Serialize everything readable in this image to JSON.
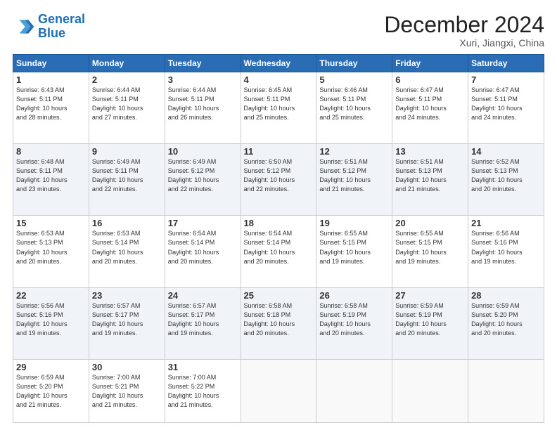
{
  "logo": {
    "line1": "General",
    "line2": "Blue"
  },
  "title": "December 2024",
  "location": "Xuri, Jiangxi, China",
  "days_of_week": [
    "Sunday",
    "Monday",
    "Tuesday",
    "Wednesday",
    "Thursday",
    "Friday",
    "Saturday"
  ],
  "weeks": [
    [
      {
        "day": "1",
        "info": "Sunrise: 6:43 AM\nSunset: 5:11 PM\nDaylight: 10 hours\nand 28 minutes."
      },
      {
        "day": "2",
        "info": "Sunrise: 6:44 AM\nSunset: 5:11 PM\nDaylight: 10 hours\nand 27 minutes."
      },
      {
        "day": "3",
        "info": "Sunrise: 6:44 AM\nSunset: 5:11 PM\nDaylight: 10 hours\nand 26 minutes."
      },
      {
        "day": "4",
        "info": "Sunrise: 6:45 AM\nSunset: 5:11 PM\nDaylight: 10 hours\nand 25 minutes."
      },
      {
        "day": "5",
        "info": "Sunrise: 6:46 AM\nSunset: 5:11 PM\nDaylight: 10 hours\nand 25 minutes."
      },
      {
        "day": "6",
        "info": "Sunrise: 6:47 AM\nSunset: 5:11 PM\nDaylight: 10 hours\nand 24 minutes."
      },
      {
        "day": "7",
        "info": "Sunrise: 6:47 AM\nSunset: 5:11 PM\nDaylight: 10 hours\nand 24 minutes."
      }
    ],
    [
      {
        "day": "8",
        "info": "Sunrise: 6:48 AM\nSunset: 5:11 PM\nDaylight: 10 hours\nand 23 minutes."
      },
      {
        "day": "9",
        "info": "Sunrise: 6:49 AM\nSunset: 5:11 PM\nDaylight: 10 hours\nand 22 minutes."
      },
      {
        "day": "10",
        "info": "Sunrise: 6:49 AM\nSunset: 5:12 PM\nDaylight: 10 hours\nand 22 minutes."
      },
      {
        "day": "11",
        "info": "Sunrise: 6:50 AM\nSunset: 5:12 PM\nDaylight: 10 hours\nand 22 minutes."
      },
      {
        "day": "12",
        "info": "Sunrise: 6:51 AM\nSunset: 5:12 PM\nDaylight: 10 hours\nand 21 minutes."
      },
      {
        "day": "13",
        "info": "Sunrise: 6:51 AM\nSunset: 5:13 PM\nDaylight: 10 hours\nand 21 minutes."
      },
      {
        "day": "14",
        "info": "Sunrise: 6:52 AM\nSunset: 5:13 PM\nDaylight: 10 hours\nand 20 minutes."
      }
    ],
    [
      {
        "day": "15",
        "info": "Sunrise: 6:53 AM\nSunset: 5:13 PM\nDaylight: 10 hours\nand 20 minutes."
      },
      {
        "day": "16",
        "info": "Sunrise: 6:53 AM\nSunset: 5:14 PM\nDaylight: 10 hours\nand 20 minutes."
      },
      {
        "day": "17",
        "info": "Sunrise: 6:54 AM\nSunset: 5:14 PM\nDaylight: 10 hours\nand 20 minutes."
      },
      {
        "day": "18",
        "info": "Sunrise: 6:54 AM\nSunset: 5:14 PM\nDaylight: 10 hours\nand 20 minutes."
      },
      {
        "day": "19",
        "info": "Sunrise: 6:55 AM\nSunset: 5:15 PM\nDaylight: 10 hours\nand 19 minutes."
      },
      {
        "day": "20",
        "info": "Sunrise: 6:55 AM\nSunset: 5:15 PM\nDaylight: 10 hours\nand 19 minutes."
      },
      {
        "day": "21",
        "info": "Sunrise: 6:56 AM\nSunset: 5:16 PM\nDaylight: 10 hours\nand 19 minutes."
      }
    ],
    [
      {
        "day": "22",
        "info": "Sunrise: 6:56 AM\nSunset: 5:16 PM\nDaylight: 10 hours\nand 19 minutes."
      },
      {
        "day": "23",
        "info": "Sunrise: 6:57 AM\nSunset: 5:17 PM\nDaylight: 10 hours\nand 19 minutes."
      },
      {
        "day": "24",
        "info": "Sunrise: 6:57 AM\nSunset: 5:17 PM\nDaylight: 10 hours\nand 19 minutes."
      },
      {
        "day": "25",
        "info": "Sunrise: 6:58 AM\nSunset: 5:18 PM\nDaylight: 10 hours\nand 20 minutes."
      },
      {
        "day": "26",
        "info": "Sunrise: 6:58 AM\nSunset: 5:19 PM\nDaylight: 10 hours\nand 20 minutes."
      },
      {
        "day": "27",
        "info": "Sunrise: 6:59 AM\nSunset: 5:19 PM\nDaylight: 10 hours\nand 20 minutes."
      },
      {
        "day": "28",
        "info": "Sunrise: 6:59 AM\nSunset: 5:20 PM\nDaylight: 10 hours\nand 20 minutes."
      }
    ],
    [
      {
        "day": "29",
        "info": "Sunrise: 6:59 AM\nSunset: 5:20 PM\nDaylight: 10 hours\nand 21 minutes."
      },
      {
        "day": "30",
        "info": "Sunrise: 7:00 AM\nSunset: 5:21 PM\nDaylight: 10 hours\nand 21 minutes."
      },
      {
        "day": "31",
        "info": "Sunrise: 7:00 AM\nSunset: 5:22 PM\nDaylight: 10 hours\nand 21 minutes."
      },
      {
        "day": "",
        "info": ""
      },
      {
        "day": "",
        "info": ""
      },
      {
        "day": "",
        "info": ""
      },
      {
        "day": "",
        "info": ""
      }
    ]
  ]
}
